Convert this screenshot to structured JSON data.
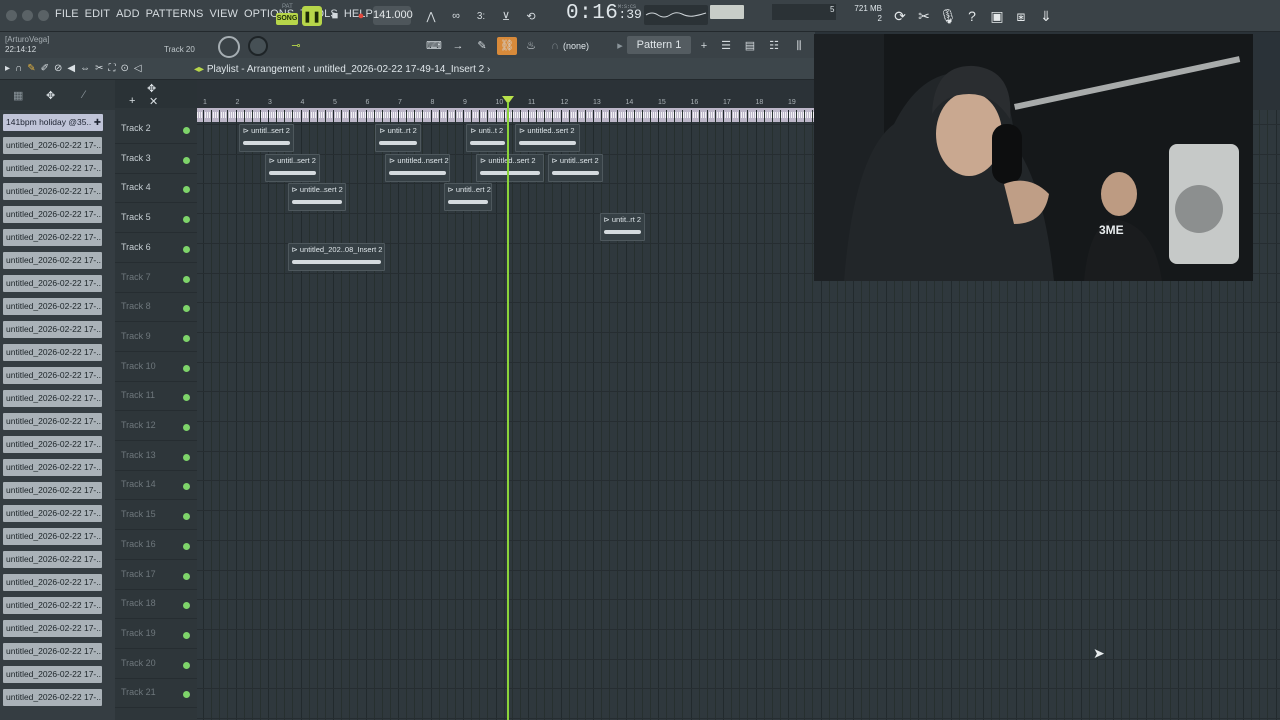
{
  "menu": [
    "FILE",
    "EDIT",
    "ADD",
    "PATTERNS",
    "VIEW",
    "OPTIONS",
    "TOOLS",
    "HELP"
  ],
  "transport": {
    "mode": "SONG",
    "pat_label": "PAT",
    "tempo": "141.000",
    "time_main": "0:16",
    "time_sub": ":39",
    "time_units": "M:S:CS"
  },
  "monitor": {
    "cpu": "5",
    "memory": "721 MB",
    "voices": "2"
  },
  "user": {
    "name": "[ArturoVega]",
    "clock": "22:14:12"
  },
  "channel": {
    "current_track": "Track 20"
  },
  "toolbar2": {
    "snap": "(none)",
    "pattern": "Pattern 1"
  },
  "playlist": {
    "title": "Playlist - Arrangement",
    "breadcrumb": "untitled_2026-02-22 17-49-14_Insert 2"
  },
  "picker": {
    "first": "141bpm holiday @35..",
    "items": [
      "untitled_2026-02-22 17-..",
      "untitled_2026-02-22 17-..",
      "untitled_2026-02-22 17-..",
      "untitled_2026-02-22 17-..",
      "untitled_2026-02-22 17-..",
      "untitled_2026-02-22 17-..",
      "untitled_2026-02-22 17-..",
      "untitled_2026-02-22 17-..",
      "untitled_2026-02-22 17-..",
      "untitled_2026-02-22 17-..",
      "untitled_2026-02-22 17-..",
      "untitled_2026-02-22 17-..",
      "untitled_2026-02-22 17-..",
      "untitled_2026-02-22 17-..",
      "untitled_2026-02-22 17-..",
      "untitled_2026-02-22 17-..",
      "untitled_2026-02-22 17-..",
      "untitled_2026-02-22 17-..",
      "untitled_2026-02-22 17-..",
      "untitled_2026-02-22 17-..",
      "untitled_2026-02-22 17-..",
      "untitled_2026-02-22 17-..",
      "untitled_2026-02-22 17-..",
      "untitled_2026-02-22 17-..",
      "untitled_2026-02-22 17-.."
    ]
  },
  "tracks": [
    "Track 2",
    "Track 3",
    "Track 4",
    "Track 5",
    "Track 6",
    "Track 7",
    "Track 8",
    "Track 9",
    "Track 10",
    "Track 11",
    "Track 12",
    "Track 13",
    "Track 14",
    "Track 15",
    "Track 16",
    "Track 17",
    "Track 18",
    "Track 19",
    "Track 20",
    "Track 21"
  ],
  "ruler": [
    "1",
    "2",
    "3",
    "4",
    "5",
    "6",
    "7",
    "8",
    "9",
    "10",
    "11",
    "12",
    "13",
    "14",
    "15",
    "16",
    "17",
    "18",
    "19"
  ],
  "clips": [
    {
      "track": 0,
      "bar": 2.1,
      "len": 1.7,
      "label": "untitl..sert 2"
    },
    {
      "track": 0,
      "bar": 6.3,
      "len": 1.4,
      "label": "untit..rt 2"
    },
    {
      "track": 0,
      "bar": 9.1,
      "len": 1.3,
      "label": "unti..t 2"
    },
    {
      "track": 0,
      "bar": 10.6,
      "len": 2.0,
      "label": "untitled..sert 2"
    },
    {
      "track": 1,
      "bar": 2.9,
      "len": 1.7,
      "label": "untitl..sert 2"
    },
    {
      "track": 1,
      "bar": 6.6,
      "len": 2.0,
      "label": "untitled..nsert 2"
    },
    {
      "track": 1,
      "bar": 9.4,
      "len": 2.1,
      "label": "untitled..sert 2"
    },
    {
      "track": 1,
      "bar": 11.6,
      "len": 1.7,
      "label": "untitl..sert 2"
    },
    {
      "track": 2,
      "bar": 3.6,
      "len": 1.8,
      "label": "untitle..sert 2"
    },
    {
      "track": 2,
      "bar": 8.4,
      "len": 1.5,
      "label": "untitl..ert 2"
    },
    {
      "track": 3,
      "bar": 13.2,
      "len": 1.4,
      "label": "untit..rt 2"
    },
    {
      "track": 4,
      "bar": 3.6,
      "len": 3.0,
      "label": "untitled_202..08_Insert 2"
    }
  ],
  "playhead_bar": 10.0,
  "colors": {
    "accent": "#8bd43a",
    "song": "#b7d64a",
    "record": "#e0483c"
  }
}
